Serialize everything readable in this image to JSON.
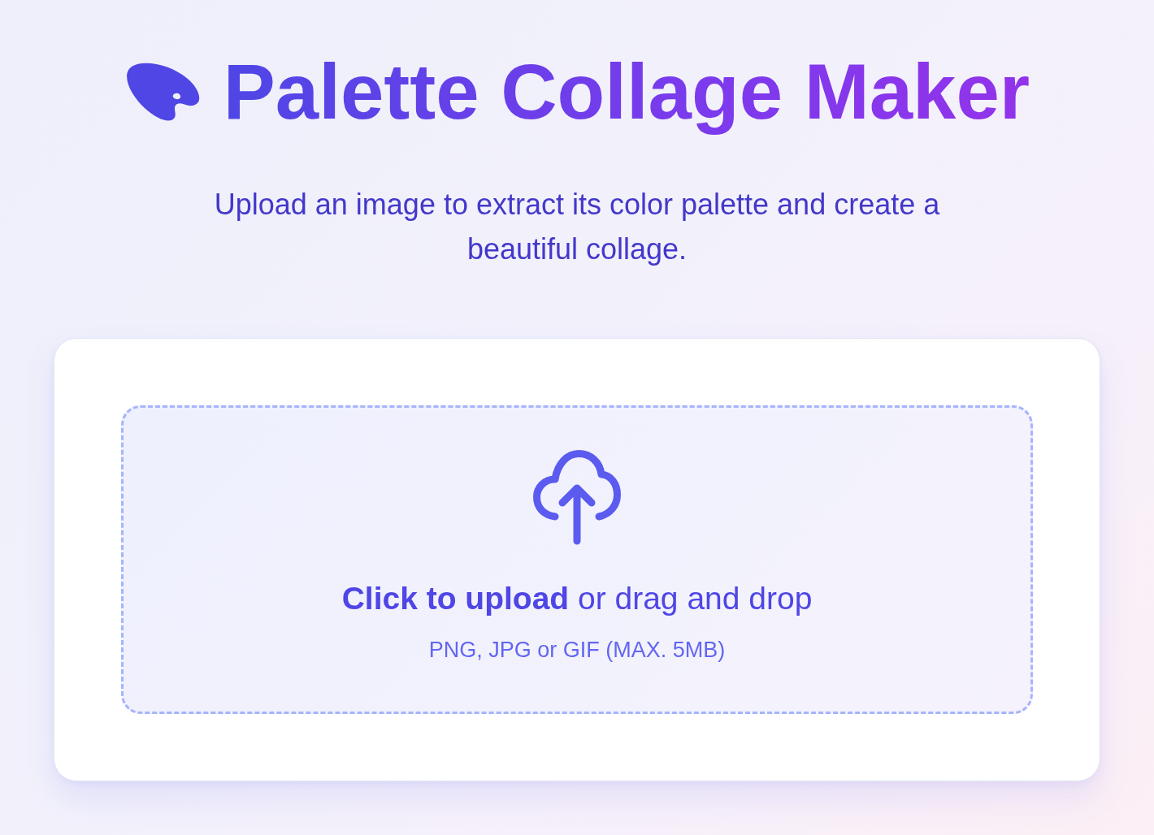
{
  "header": {
    "title": "Palette Collage Maker",
    "subtitle": "Upload an image to extract its color palette and create a beautiful collage."
  },
  "upload": {
    "prompt": "**Click to upload** or drag and drop",
    "hint": "PNG, JPG or GIF (MAX. 5MB)"
  }
}
